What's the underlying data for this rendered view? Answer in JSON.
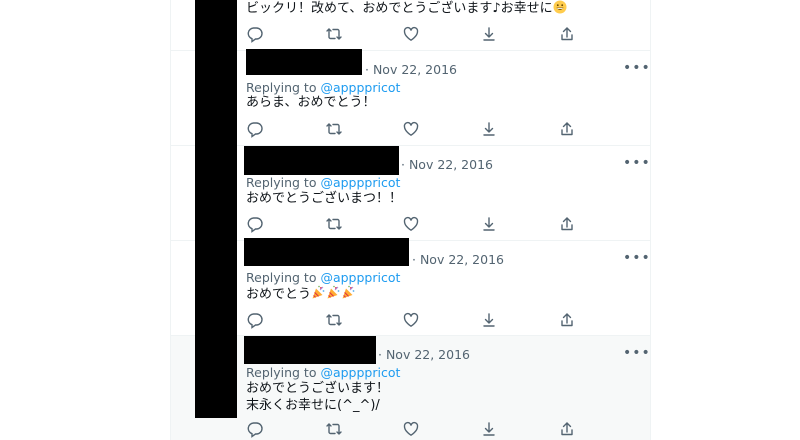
{
  "top_tweet": {
    "text": "ビックリ！改めて、おめでとうございます♪お幸せに",
    "emoji": "grinning-face-emoji"
  },
  "replies": [
    {
      "date": "· Nov 22, 2016",
      "replying_prefix": "Replying to ",
      "handle": "@appppricot",
      "lines": [
        "あらま、おめでとう！"
      ]
    },
    {
      "date": "· Nov 22, 2016",
      "replying_prefix": "Replying to ",
      "handle": "@appppricot",
      "lines": [
        "おめでとうございまつ！！"
      ]
    },
    {
      "date": "· Nov 22, 2016",
      "replying_prefix": "Replying to ",
      "handle": "@appppricot",
      "lines": [
        "おめでとう"
      ],
      "emojis": [
        "party-popper-emoji",
        "party-popper-emoji",
        "party-popper-emoji"
      ]
    },
    {
      "date": "· Nov 22, 2016",
      "replying_prefix": "Replying to ",
      "handle": "@appppricot",
      "lines": [
        "おめでとうございます！",
        "末永くお幸せに(^_^)/"
      ]
    }
  ],
  "more_label": "•••",
  "action_icons": [
    "reply-icon",
    "retweet-icon",
    "like-icon",
    "bookmark-icon",
    "share-icon"
  ],
  "colors": {
    "secondary_text": "#536471",
    "link": "#1d9bf0",
    "divider": "#eff3f4",
    "highlight_bg": "#f7f9f9"
  }
}
